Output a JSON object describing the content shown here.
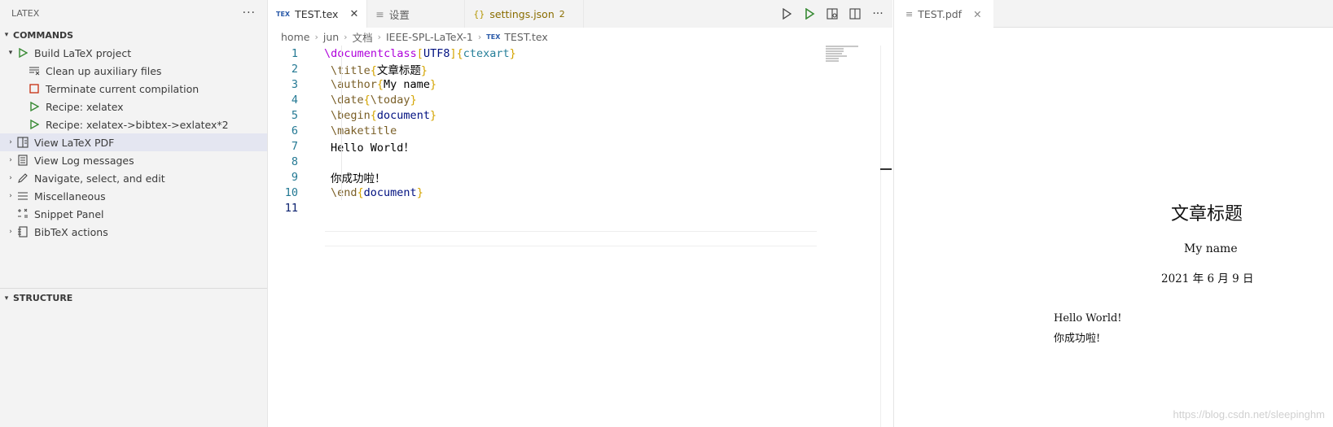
{
  "sidebar": {
    "title": "LATEX",
    "more": "···",
    "commands_section": "COMMANDS",
    "structure_section": "STRUCTURE",
    "items": [
      {
        "label": "Build LaTeX project"
      },
      {
        "label": "Clean up auxiliary files"
      },
      {
        "label": "Terminate current compilation"
      },
      {
        "label": "Recipe: xelatex"
      },
      {
        "label": "Recipe: xelatex->bibtex->exlatex*2"
      },
      {
        "label": "View LaTeX PDF"
      },
      {
        "label": "View Log messages"
      },
      {
        "label": "Navigate, select, and edit"
      },
      {
        "label": "Miscellaneous"
      },
      {
        "label": "Snippet Panel"
      },
      {
        "label": "BibTeX actions"
      }
    ]
  },
  "editor": {
    "tabs": [
      {
        "label": "TEST.tex",
        "close": "✕"
      },
      {
        "label": "设置"
      },
      {
        "label": "settings.json",
        "badge": "2"
      }
    ],
    "breadcrumb": [
      "home",
      "jun",
      "文档",
      "IEEE-SPL-LaTeX-1",
      "TEST.tex"
    ],
    "lines": [
      {
        "n": "1",
        "a": "\\documentclass",
        "b": "[",
        "c": "UTF8",
        "d": "]{",
        "e": "ctexart",
        "f": "}"
      },
      {
        "n": "2",
        "a": "\\title",
        "b": "{",
        "c": "文章标题",
        "d": "}"
      },
      {
        "n": "3",
        "a": "\\author",
        "b": "{",
        "c": "My name",
        "d": "}"
      },
      {
        "n": "4",
        "a": "\\date",
        "b": "{",
        "c": "\\today",
        "d": "}"
      },
      {
        "n": "5",
        "a": "\\begin",
        "b": "{",
        "c": "document",
        "d": "}"
      },
      {
        "n": "6",
        "a": "\\maketitle"
      },
      {
        "n": "7",
        "a": "Hello World！"
      },
      {
        "n": "8",
        "a": ""
      },
      {
        "n": "9",
        "a": "你成功啦！"
      },
      {
        "n": "10",
        "a": "\\end",
        "b": "{",
        "c": "document",
        "d": "}"
      },
      {
        "n": "11",
        "a": ""
      }
    ]
  },
  "pdf": {
    "tab_label": "TEST.pdf",
    "close": "✕",
    "title": "文章标题",
    "author": "My name",
    "date": "2021 年 6 月 9 日",
    "body1": "Hello World!",
    "body2": "你成功啦!"
  },
  "watermark": "https://blog.csdn.net/sleepinghm"
}
